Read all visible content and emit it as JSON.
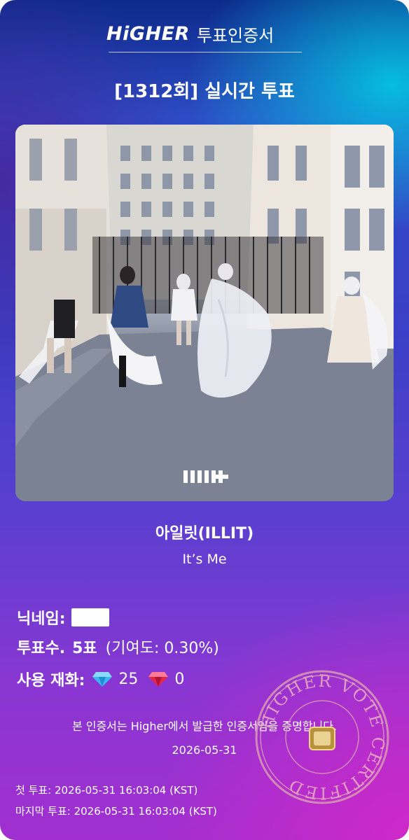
{
  "header": {
    "logo": "HiGHER",
    "suffix": "투표인증서"
  },
  "round_title": "[1312회] 실시간 투표",
  "album": {
    "image_description": "group photo in Paris courtyard",
    "cover_mark": "ıllıt"
  },
  "artist": "아일릿(ILLIT)",
  "song": "It’s Me",
  "info": {
    "nickname_label": "닉네임:",
    "votes_label": "투표수.",
    "votes_value": "5표",
    "contribution": "(기여도: 0.30%)",
    "currency_label": "사용 재화:",
    "diamond_blue_count": "25",
    "diamond_red_count": "0"
  },
  "certify_text": "본 인증서는 Higher에서 발급한 인증서임을 증명합니다.",
  "certify_date": "2026-05-31",
  "first_vote": "첫 투표: 2026-05-31 16:03:04 (KST)",
  "last_vote": "마지막 투표: 2026-05-31 16:03:04 (KST)",
  "stamp": {
    "ring_text": "HIGHER VOTE CERTIFIED"
  },
  "colors": {
    "gradient_top": "#0c2a8a",
    "gradient_mid": "#3b3fc7",
    "gradient_bottom": "#a12fcf",
    "accent_cyan": "#00d2e6",
    "diamond_blue": "#3fb6f2",
    "diamond_red": "#e0284f"
  }
}
